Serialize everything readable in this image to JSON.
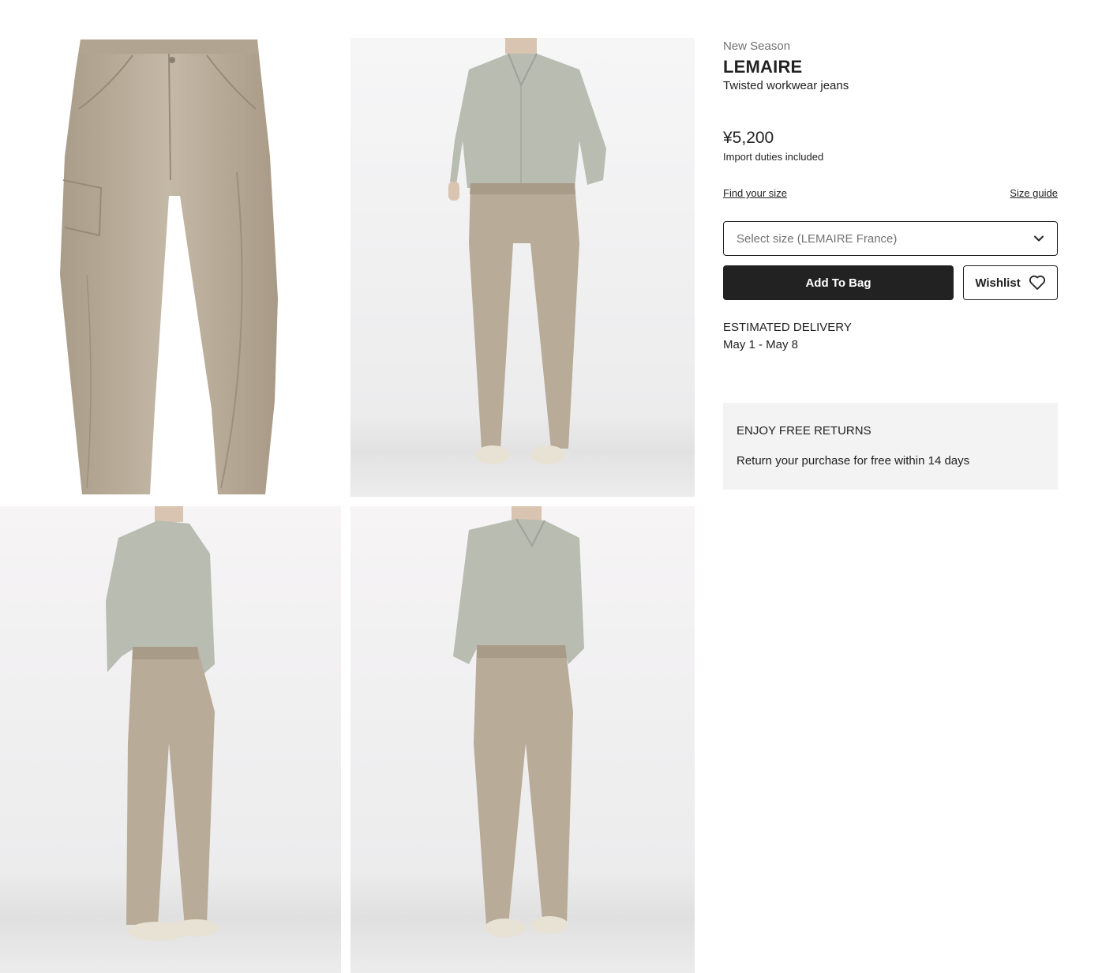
{
  "product": {
    "season_label": "New Season",
    "brand": "LEMAIRE",
    "name": "Twisted workwear jeans",
    "price": "¥5,200",
    "duties_note": "Import duties included"
  },
  "size_links": {
    "find_size": "Find your size",
    "size_guide": "Size guide"
  },
  "size_select": {
    "placeholder": "Select size (LEMAIRE France)"
  },
  "actions": {
    "add_to_bag": "Add To Bag",
    "wishlist": "Wishlist"
  },
  "delivery": {
    "label": "ESTIMATED DELIVERY",
    "dates": "May 1 - May 8"
  },
  "returns": {
    "title": "ENJOY FREE RETURNS",
    "description": "Return your purchase for free within 14 days"
  },
  "colors": {
    "primary": "#222222",
    "muted": "#727272",
    "panel": "#f3f3f3",
    "denim": "#b8ab98",
    "shirt": "#b9bcb1",
    "studio_bg": "#efeff0"
  },
  "gallery": [
    {
      "icon": "flat-lay-jeans-image"
    },
    {
      "icon": "model-front-image"
    },
    {
      "icon": "model-side-image"
    },
    {
      "icon": "model-three-quarter-image"
    }
  ]
}
